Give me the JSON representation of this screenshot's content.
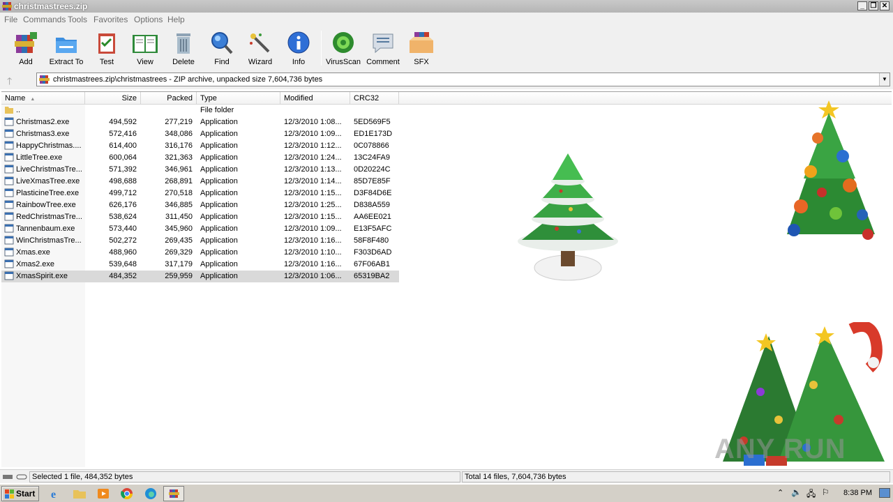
{
  "window": {
    "title": "christmastrees.zip"
  },
  "menu": [
    "File",
    "Commands",
    "Tools",
    "Favorites",
    "Options",
    "Help"
  ],
  "toolbar": [
    {
      "label": "Add",
      "icon": "add-archive-icon"
    },
    {
      "label": "Extract To",
      "icon": "extract-folder-icon"
    },
    {
      "label": "Test",
      "icon": "test-clipboard-icon"
    },
    {
      "label": "View",
      "icon": "view-book-icon"
    },
    {
      "label": "Delete",
      "icon": "trash-icon"
    },
    {
      "label": "Find",
      "icon": "magnifier-icon"
    },
    {
      "label": "Wizard",
      "icon": "magic-wand-icon"
    },
    {
      "label": "Info",
      "icon": "info-icon"
    },
    {
      "label": "VirusScan",
      "icon": "virus-scan-icon"
    },
    {
      "label": "Comment",
      "icon": "comment-icon"
    },
    {
      "label": "SFX",
      "icon": "sfx-box-icon"
    }
  ],
  "address": {
    "path": "christmastrees.zip\\christmastrees - ZIP archive, unpacked size 7,604,736 bytes"
  },
  "columns": {
    "name": "Name",
    "size": "Size",
    "packed": "Packed",
    "type": "Type",
    "modified": "Modified",
    "crc": "CRC32"
  },
  "files": [
    {
      "name": "..",
      "size": "",
      "packed": "",
      "type": "File folder",
      "modified": "",
      "crc": "",
      "kind": "folder"
    },
    {
      "name": "Christmas2.exe",
      "size": "494,592",
      "packed": "277,219",
      "type": "Application",
      "modified": "12/3/2010 1:08...",
      "crc": "5ED569F5",
      "kind": "exe"
    },
    {
      "name": "Christmas3.exe",
      "size": "572,416",
      "packed": "348,086",
      "type": "Application",
      "modified": "12/3/2010 1:09...",
      "crc": "ED1E173D",
      "kind": "exe"
    },
    {
      "name": "HappyChristmas....",
      "size": "614,400",
      "packed": "316,176",
      "type": "Application",
      "modified": "12/3/2010 1:12...",
      "crc": "0C078866",
      "kind": "exe"
    },
    {
      "name": "LittleTree.exe",
      "size": "600,064",
      "packed": "321,363",
      "type": "Application",
      "modified": "12/3/2010 1:24...",
      "crc": "13C24FA9",
      "kind": "exe"
    },
    {
      "name": "LiveChristmasTre...",
      "size": "571,392",
      "packed": "346,961",
      "type": "Application",
      "modified": "12/3/2010 1:13...",
      "crc": "0D20224C",
      "kind": "exe"
    },
    {
      "name": "LiveXmasTree.exe",
      "size": "498,688",
      "packed": "268,891",
      "type": "Application",
      "modified": "12/3/2010 1:14...",
      "crc": "85D7E85F",
      "kind": "exe"
    },
    {
      "name": "PlasticineTree.exe",
      "size": "499,712",
      "packed": "270,518",
      "type": "Application",
      "modified": "12/3/2010 1:15...",
      "crc": "D3F84D6E",
      "kind": "exe"
    },
    {
      "name": "RainbowTree.exe",
      "size": "626,176",
      "packed": "346,885",
      "type": "Application",
      "modified": "12/3/2010 1:25...",
      "crc": "D838A559",
      "kind": "exe"
    },
    {
      "name": "RedChristmasTre...",
      "size": "538,624",
      "packed": "311,450",
      "type": "Application",
      "modified": "12/3/2010 1:15...",
      "crc": "AA6EE021",
      "kind": "exe"
    },
    {
      "name": "Tannenbaum.exe",
      "size": "573,440",
      "packed": "345,960",
      "type": "Application",
      "modified": "12/3/2010 1:09...",
      "crc": "E13F5AFC",
      "kind": "exe"
    },
    {
      "name": "WinChristmasTre...",
      "size": "502,272",
      "packed": "269,435",
      "type": "Application",
      "modified": "12/3/2010 1:16...",
      "crc": "58F8F480",
      "kind": "exe"
    },
    {
      "name": "Xmas.exe",
      "size": "488,960",
      "packed": "269,329",
      "type": "Application",
      "modified": "12/3/2010 1:10...",
      "crc": "F303D6AD",
      "kind": "exe"
    },
    {
      "name": "Xmas2.exe",
      "size": "539,648",
      "packed": "317,179",
      "type": "Application",
      "modified": "12/3/2010 1:16...",
      "crc": "67F06AB1",
      "kind": "exe"
    },
    {
      "name": "XmasSpirit.exe",
      "size": "484,352",
      "packed": "259,959",
      "type": "Application",
      "modified": "12/3/2010 1:06...",
      "crc": "65319BA2",
      "kind": "exe",
      "selected": true
    }
  ],
  "status": {
    "left": "Selected 1 file, 484,352 bytes",
    "right": "Total 14 files, 7,604,736 bytes"
  },
  "taskbar": {
    "start": "Start",
    "apps": [
      "ie-icon",
      "explorer-folder-icon",
      "media-player-icon",
      "chrome-icon",
      "edge-icon",
      "winrar-icon"
    ],
    "clock": "8:38 PM"
  },
  "watermark": "ANY RUN"
}
